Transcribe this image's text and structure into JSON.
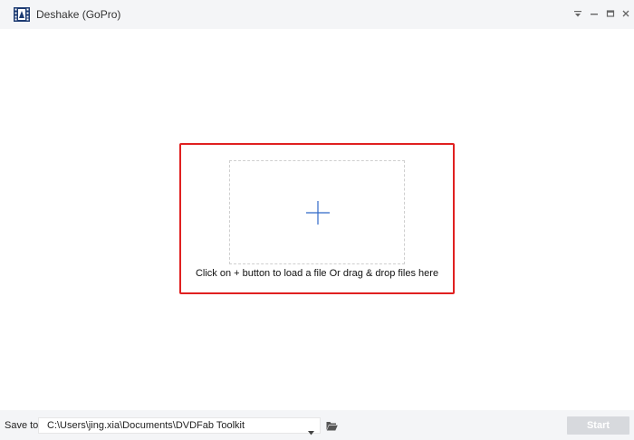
{
  "window": {
    "title": "Deshake (GoPro)",
    "app_icon": "film-strip-icon",
    "controls": [
      "menu-dropdown-icon",
      "minimize-icon",
      "maximize-icon",
      "close-icon"
    ]
  },
  "main": {
    "add_icon": "plus-icon",
    "hint": "Click on + button to load a file Or drag & drop files here",
    "colors": {
      "highlight_border": "#e02020",
      "plus_color": "#2f67c8"
    }
  },
  "footer": {
    "save_to_label": "Save to:",
    "save_path": "C:\\Users\\jing.xia\\Documents\\DVDFab Toolkit",
    "folder_icon": "folder-open-icon",
    "start_label": "Start"
  }
}
